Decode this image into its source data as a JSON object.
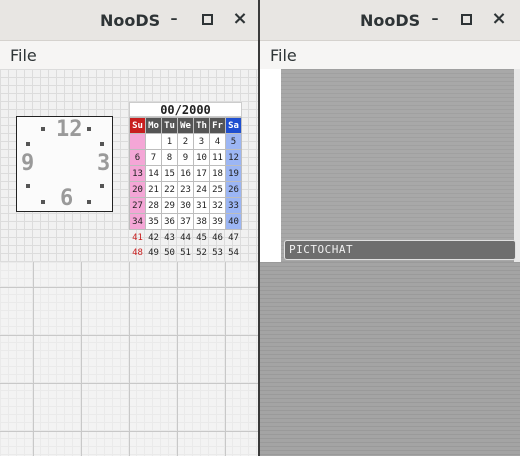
{
  "windows": {
    "left": {
      "title": "NooDS",
      "minimize_label": "–",
      "maximize_label": "□",
      "close_label": "×",
      "menu_file": "File"
    },
    "right": {
      "title": "NooDS",
      "minimize_label": "–",
      "maximize_label": "□",
      "close_label": "×",
      "menu_file": "File"
    }
  },
  "clock": {
    "n12": "12",
    "n3": "3",
    "n6": "6",
    "n9": "9"
  },
  "calendar": {
    "header": "00/2000",
    "days": [
      "Su",
      "Mo",
      "Tu",
      "We",
      "Th",
      "Fr",
      "Sa"
    ],
    "rows": [
      [
        "",
        "",
        "1",
        "2",
        "3",
        "4",
        "5"
      ],
      [
        "6",
        "7",
        "8",
        "9",
        "10",
        "11",
        "12"
      ],
      [
        "13",
        "14",
        "15",
        "16",
        "17",
        "18",
        "19"
      ],
      [
        "20",
        "21",
        "22",
        "23",
        "24",
        "25",
        "26"
      ],
      [
        "27",
        "28",
        "29",
        "30",
        "31",
        "32",
        "33"
      ],
      [
        "34",
        "35",
        "36",
        "37",
        "38",
        "39",
        "40"
      ],
      [
        "41",
        "42",
        "43",
        "44",
        "45",
        "46",
        "47"
      ],
      [
        "48",
        "49",
        "50",
        "51",
        "52",
        "53",
        "54"
      ]
    ]
  },
  "pictochat": {
    "label": "PICTOCHAT"
  }
}
